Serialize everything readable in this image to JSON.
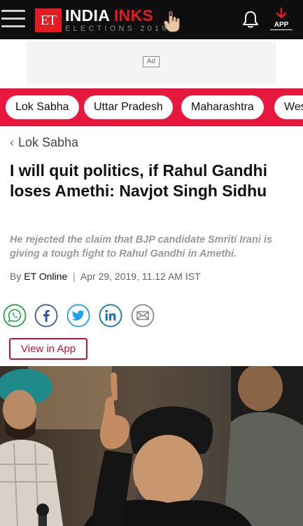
{
  "header": {
    "logo_letters": "ET",
    "brand_main": "INDIA",
    "brand_accent": "INKS",
    "brand_sub": "ELECTIONS 2019",
    "app_label": "APP"
  },
  "ad": {
    "label": "Ad"
  },
  "nav": {
    "chips": [
      "Lok Sabha",
      "Uttar Pradesh",
      "Maharashtra",
      "West Bengal"
    ]
  },
  "breadcrumb": {
    "label": "Lok Sabha"
  },
  "article": {
    "headline": "I will quit politics, if Rahul Gandhi loses Amethi: Navjot Singh Sidhu",
    "synopsis": "He rejected the claim that BJP candidate Smriti Irani is giving a tough fight to Rahul Gandhi in Amethi.",
    "byline_prefix": "By",
    "author": "ET Online",
    "separator": "|",
    "datetime": "Apr 29, 2019, 11.12 AM IST"
  },
  "share": {
    "icons": [
      "whatsapp-icon",
      "facebook-icon",
      "twitter-icon",
      "linkedin-icon",
      "email-icon"
    ]
  },
  "view_in_app": {
    "label": "View in App"
  },
  "colors": {
    "header_bg": "#0e0e0e",
    "brand_red": "#e41b23",
    "nav_strip": "#e7173d",
    "whatsapp": "#25a244",
    "facebook": "#3b5998",
    "twitter": "#1da1f2",
    "linkedin": "#0e76a8",
    "email": "#888888",
    "view_app": "#c2123a"
  }
}
